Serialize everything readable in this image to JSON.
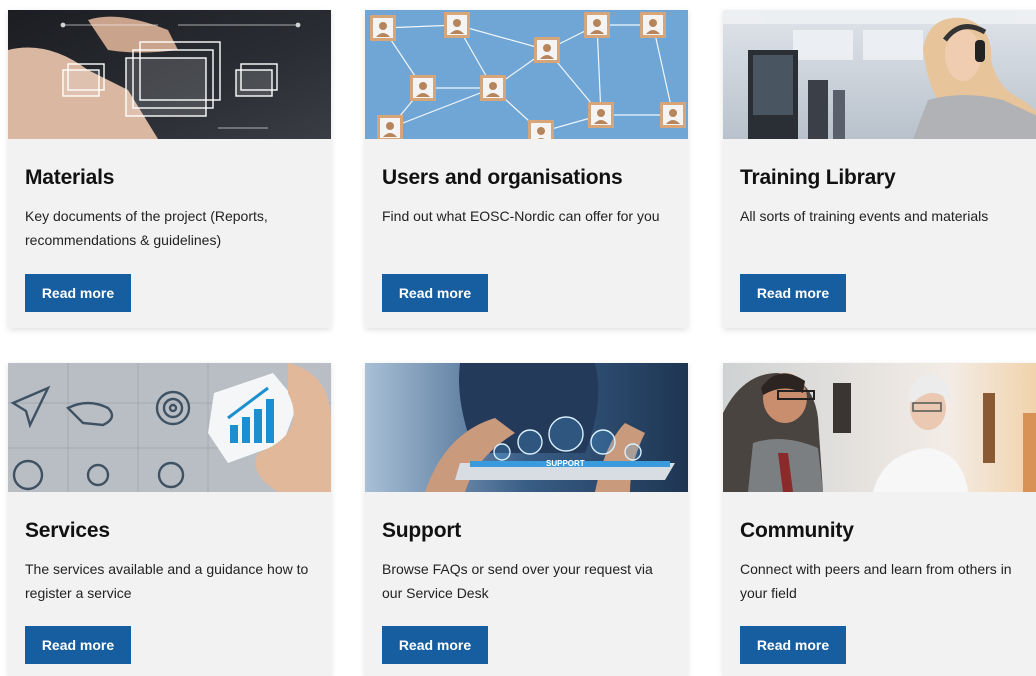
{
  "cards": [
    {
      "title": "Materials",
      "description": "Key documents of the project (Reports, recommendations & guidelines)",
      "button_label": "Read more",
      "image": "hand-touching-folder-icons-image"
    },
    {
      "title": "Users and organisations",
      "description": "Find out what EOSC-Nordic can offer for you",
      "button_label": "Read more",
      "image": "network-of-user-icons-image"
    },
    {
      "title": "Training Library",
      "description": "All sorts of training events and materials",
      "button_label": "Read more",
      "image": "person-with-headset-at-computer-image"
    },
    {
      "title": "Services",
      "description": "The services available and a guidance how to register a service",
      "button_label": "Read more",
      "image": "puzzle-with-business-icons-image"
    },
    {
      "title": "Support",
      "description": "Browse FAQs or send over your request via our Service Desk",
      "button_label": "Read more",
      "image": "tablet-support-icons-image",
      "image_text": "SUPPORT"
    },
    {
      "title": "Community",
      "description": "Connect with peers and learn from others in your field",
      "button_label": "Read more",
      "image": "people-talking-in-office-image"
    }
  ],
  "colors": {
    "button": "#175ea0",
    "card_background": "#f2f2f2"
  }
}
